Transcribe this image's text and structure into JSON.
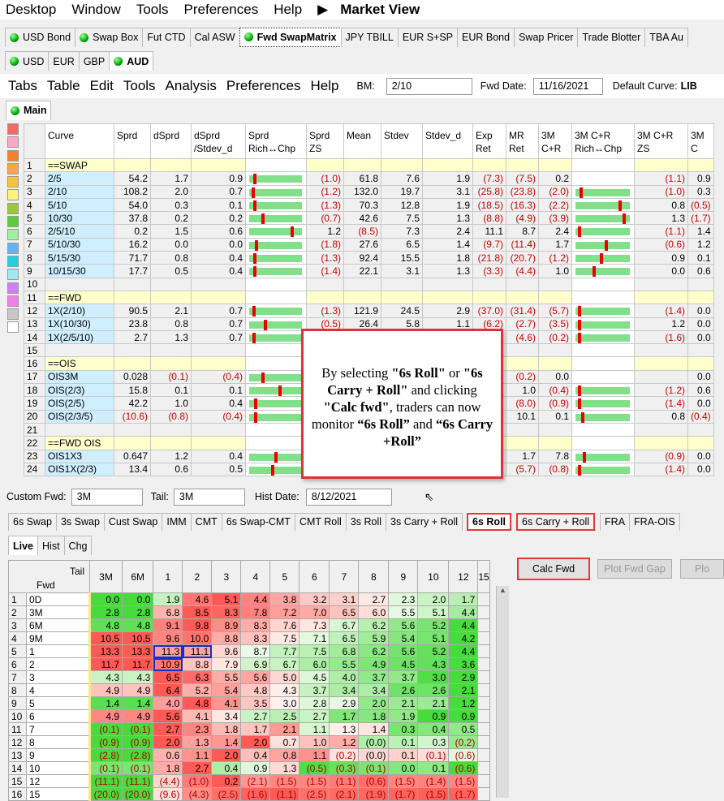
{
  "menubar": {
    "items": [
      "Desktop",
      "Window",
      "Tools",
      "Preferences",
      "Help"
    ],
    "title": "Market View"
  },
  "tabs_top": [
    "USD Bond",
    "Swap Box",
    "Fut CTD",
    "Cal ASW",
    "Fwd SwapMatrix",
    "JPY TBILL",
    "EUR S+SP",
    "EUR Bond",
    "Swap Pricer",
    "Trade Blotter",
    "TBA Au"
  ],
  "tabs_ccy": [
    "USD",
    "EUR",
    "GBP",
    "AUD"
  ],
  "menu2": {
    "items": [
      "Tabs",
      "Table",
      "Edit",
      "Tools",
      "Analysis",
      "Preferences",
      "Help"
    ],
    "bm_label": "BM:",
    "bm_value": "2/10",
    "fwd_date_label": "Fwd Date:",
    "fwd_date": "11/16/2021",
    "default_curve_label": "Default Curve:",
    "default_curve": "LIB"
  },
  "main_tab": "Main",
  "grid1": {
    "headers": [
      "Curve",
      "Sprd",
      "dSprd",
      "dSprd /Stdev_d",
      "Sprd Rich↔Chp",
      "Sprd ZS",
      "Mean",
      "Stdev",
      "Stdev_d",
      "Exp Ret",
      "MR Ret",
      "3M C+R",
      "3M C+R Rich↔Chp",
      "3M C+R ZS",
      "3M C"
    ],
    "rows": [
      [
        "1",
        "==SWAP",
        "",
        "",
        "",
        "",
        "",
        "",
        "",
        "",
        "",
        "",
        "",
        "",
        "",
        ""
      ],
      [
        "2",
        "2/5",
        "54.2",
        "1.7",
        "0.9",
        "",
        "(1.0)",
        "61.8",
        "7.6",
        "1.9",
        "(7.3)",
        "(7.5)",
        "0.2",
        "",
        "(1.1)",
        "0.9"
      ],
      [
        "3",
        "2/10",
        "108.2",
        "2.0",
        "0.7",
        "",
        "(1.2)",
        "132.0",
        "19.7",
        "3.1",
        "(25.8)",
        "(23.8)",
        "(2.0)",
        "",
        "(1.0)",
        "0.3"
      ],
      [
        "4",
        "5/10",
        "54.0",
        "0.3",
        "0.1",
        "",
        "(1.3)",
        "70.3",
        "12.8",
        "1.9",
        "(18.5)",
        "(16.3)",
        "(2.2)",
        "",
        "0.8",
        "(0.5)"
      ],
      [
        "5",
        "10/30",
        "37.8",
        "0.2",
        "0.2",
        "",
        "(0.7)",
        "42.6",
        "7.5",
        "1.3",
        "(8.8)",
        "(4.9)",
        "(3.9)",
        "",
        "1.3",
        "(1.7)"
      ],
      [
        "6",
        "2/5/10",
        "0.2",
        "1.5",
        "0.6",
        "",
        "1.2",
        "(8.5)",
        "7.3",
        "2.4",
        "11.1",
        "8.7",
        "2.4",
        "",
        "(1.1)",
        "1.4"
      ],
      [
        "7",
        "5/10/30",
        "16.2",
        "0.0",
        "0.0",
        "",
        "(1.8)",
        "27.6",
        "6.5",
        "1.4",
        "(9.7)",
        "(11.4)",
        "1.7",
        "",
        "(0.6)",
        "1.2"
      ],
      [
        "8",
        "5/15/30",
        "71.7",
        "0.8",
        "0.4",
        "",
        "(1.3)",
        "92.4",
        "15.5",
        "1.8",
        "(21.8)",
        "(20.7)",
        "(1.2)",
        "",
        "0.9",
        "0.1"
      ],
      [
        "9",
        "10/15/30",
        "17.7",
        "0.5",
        "0.4",
        "",
        "(1.4)",
        "22.1",
        "3.1",
        "1.3",
        "(3.3)",
        "(4.4)",
        "1.0",
        "",
        "0.0",
        "0.6"
      ],
      [
        "10",
        "",
        "",
        "",
        "",
        "",
        "",
        "",
        "",
        "",
        "",
        "",
        "",
        "",
        "",
        ""
      ],
      [
        "11",
        "==FWD",
        "",
        "",
        "",
        "",
        "",
        "",
        "",
        "",
        "",
        "",
        "",
        "",
        "",
        ""
      ],
      [
        "12",
        "1X(2/10)",
        "90.5",
        "2.1",
        "0.7",
        "",
        "(1.3)",
        "121.9",
        "24.5",
        "2.9",
        "(37.0)",
        "(31.4)",
        "(5.7)",
        "",
        "(1.4)",
        "0.0"
      ],
      [
        "13",
        "1X(10/30)",
        "23.8",
        "0.8",
        "0.7",
        "",
        "(0.5)",
        "26.4",
        "5.8",
        "1.1",
        "(6.2)",
        "(2.7)",
        "(3.5)",
        "",
        "1.2",
        "0.0"
      ],
      [
        "14",
        "1X(2/5/10)",
        "2.7",
        "1.3",
        "0.7",
        "",
        "",
        "",
        "",
        "",
        "(5.8)",
        "(4.6)",
        "(0.2)",
        "",
        "(1.6)",
        "0.0"
      ],
      [
        "15",
        "",
        "",
        "",
        "",
        "",
        "",
        "",
        "",
        "",
        "",
        "",
        "",
        "",
        "",
        ""
      ],
      [
        "16",
        "==OIS",
        "",
        "",
        "",
        "",
        "",
        "",
        "",
        "",
        "",
        "",
        "",
        "",
        "",
        ""
      ],
      [
        "17",
        "OIS3M",
        "0.028",
        "(0.1)",
        "(0.4)",
        "",
        "",
        "",
        "",
        "",
        "(0.2)",
        "(0.2)",
        "0.0",
        "",
        "",
        "0.0"
      ],
      [
        "18",
        "OIS(2/3)",
        "15.8",
        "0.1",
        "0.1",
        "",
        "",
        "",
        "",
        "",
        "1.7",
        "1.0",
        "(0.4)",
        "",
        "(1.2)",
        "0.6"
      ],
      [
        "19",
        "OIS(2/5)",
        "42.2",
        "1.0",
        "0.4",
        "",
        "",
        "",
        "",
        "",
        "(8.9)",
        "(8.0)",
        "(0.9)",
        "",
        "(1.4)",
        "0.0"
      ],
      [
        "20",
        "OIS(2/3/5)",
        "(10.6)",
        "(0.8)",
        "(0.4)",
        "",
        "",
        "",
        "",
        "",
        "10.2",
        "10.1",
        "0.1",
        "",
        "0.8",
        "(0.4)"
      ],
      [
        "21",
        "",
        "",
        "",
        "",
        "",
        "",
        "",
        "",
        "",
        "",
        "",
        "",
        "",
        "",
        ""
      ],
      [
        "22",
        "==FWD OIS",
        "",
        "",
        "",
        "",
        "",
        "",
        "",
        "",
        "",
        "",
        "",
        "",
        "",
        ""
      ],
      [
        "23",
        "OIS1X3",
        "0.647",
        "1.2",
        "0.4",
        "",
        "",
        "",
        "",
        "",
        "9.4",
        "1.7",
        "7.8",
        "",
        "(0.9)",
        "0.0"
      ],
      [
        "24",
        "OIS1X(2/3)",
        "13.4",
        "0.6",
        "0.5",
        "",
        "",
        "",
        "",
        "",
        "(6.5)",
        "(5.7)",
        "(0.8)",
        "",
        "(1.4)",
        "0.0"
      ]
    ]
  },
  "callout": {
    "l1": "By selecting ",
    "b1": "\"6s Roll\"",
    "l2": " or ",
    "b2": "\"6s Carry + Roll\"",
    "l3": " and clicking ",
    "b3": "\"Calc fwd\"",
    "l4": ", traders can now monitor ",
    "b4": "“6s Roll”",
    "l5": " and ",
    "b5": "“6s Carry +Roll”"
  },
  "lower": {
    "custom_fwd_label": "Custom Fwd:",
    "custom_fwd": "3M",
    "tail_label": "Tail:",
    "tail": "3M",
    "hist_date_label": "Hist Date:",
    "hist_date": "8/12/2021",
    "tabs": [
      "6s Swap",
      "3s Swap",
      "Cust Swap",
      "IMM",
      "CMT",
      "6s Swap-CMT",
      "CMT Roll",
      "3s Roll",
      "3s Carry + Roll",
      "6s Roll",
      "6s Carry + Roll",
      "FRA",
      "FRA-OIS"
    ],
    "subtabs": [
      "Live",
      "Hist",
      "Chg"
    ],
    "buttons": {
      "calc": "Calc Fwd",
      "plot": "Plot Fwd Gap",
      "plo": "Plo"
    }
  },
  "grid2": {
    "corner_tail": "Tail",
    "corner_fwd": "Fwd",
    "cols": [
      "3M",
      "6M",
      "1",
      "2",
      "3",
      "4",
      "5",
      "6",
      "7",
      "8",
      "9",
      "10",
      "12",
      "15"
    ],
    "rows": [
      [
        "1",
        "0D",
        "0.0",
        "0.0",
        "1.9",
        "4.6",
        "5.1",
        "4.4",
        "3.8",
        "3.2",
        "3.1",
        "2.7",
        "2.3",
        "2.0",
        "1.7",
        ""
      ],
      [
        "2",
        "3M",
        "2.8",
        "2.8",
        "6.8",
        "8.5",
        "8.3",
        "7.8",
        "7.2",
        "7.0",
        "6.5",
        "6.0",
        "5.5",
        "5.1",
        "4.4",
        ""
      ],
      [
        "3",
        "6M",
        "4.8",
        "4.8",
        "9.1",
        "9.8",
        "8.9",
        "8.3",
        "7.6",
        "7.3",
        "6.7",
        "6.2",
        "5.6",
        "5.2",
        "4.4",
        ""
      ],
      [
        "4",
        "9M",
        "10.5",
        "10.5",
        "9.6",
        "10.0",
        "8.8",
        "8.3",
        "7.5",
        "7.1",
        "6.5",
        "5.9",
        "5.4",
        "5.1",
        "4.2",
        ""
      ],
      [
        "5",
        "1",
        "13.3",
        "13.3",
        "11.3",
        "11.1",
        "9.6",
        "8.7",
        "7.7",
        "7.5",
        "6.8",
        "6.2",
        "5.6",
        "5.2",
        "4.4",
        ""
      ],
      [
        "6",
        "2",
        "11.7",
        "11.7",
        "10.9",
        "8.8",
        "7.9",
        "6.9",
        "6.7",
        "6.0",
        "5.5",
        "4.9",
        "4.5",
        "4.3",
        "3.6",
        ""
      ],
      [
        "7",
        "3",
        "4.3",
        "4.3",
        "6.5",
        "6.3",
        "5.5",
        "5.6",
        "5.0",
        "4.5",
        "4.0",
        "3.7",
        "3.7",
        "3.0",
        "2.9",
        ""
      ],
      [
        "8",
        "4",
        "4.9",
        "4.9",
        "6.4",
        "5.2",
        "5.4",
        "4.8",
        "4.3",
        "3.7",
        "3.4",
        "3.4",
        "2.6",
        "2.6",
        "2.1",
        ""
      ],
      [
        "9",
        "5",
        "1.4",
        "1.4",
        "4.0",
        "4.8",
        "4.1",
        "3.5",
        "3.0",
        "2.8",
        "2.9",
        "2.0",
        "2.1",
        "2.1",
        "1.2",
        ""
      ],
      [
        "10",
        "6",
        "4.9",
        "4.9",
        "5.6",
        "4.1",
        "3.4",
        "2.7",
        "2.5",
        "2.7",
        "1.7",
        "1.8",
        "1.9",
        "0.9",
        "0.9",
        ""
      ],
      [
        "11",
        "7",
        "(0.1)",
        "(0.1)",
        "2.7",
        "2.3",
        "1.8",
        "1.7",
        "2.1",
        "1.1",
        "1.3",
        "1.4",
        "0.3",
        "0.4",
        "0.5",
        ""
      ],
      [
        "12",
        "8",
        "(0.9)",
        "(0.9)",
        "2.0",
        "1.3",
        "1.4",
        "2.0",
        "0.7",
        "1.0",
        "1.2",
        "(0.0)",
        "0.1",
        "0.3",
        "(0.2)",
        ""
      ],
      [
        "13",
        "9",
        "(2.8)",
        "(2.8)",
        "0.6",
        "1.1",
        "2.0",
        "0.4",
        "0.8",
        "1.1",
        "(0.2)",
        "(0.0)",
        "0.1",
        "(0.1)",
        "(0.6)",
        ""
      ],
      [
        "14",
        "10",
        "(0.1)",
        "(0.1)",
        "1.8",
        "2.7",
        "0.4",
        "0.9",
        "1.3",
        "(0.5)",
        "(0.3)",
        "(0.1)",
        "0.0",
        "0.1",
        "(0.6)",
        ""
      ],
      [
        "15",
        "12",
        "(11.1)",
        "(11.1)",
        "(4.4)",
        "(1.0)",
        "0.2",
        "(2.1)",
        "(1.5)",
        "(1.5)",
        "(1.1)",
        "(0.6)",
        "(1.5)",
        "(1.4)",
        "(1.5)",
        ""
      ],
      [
        "16",
        "15",
        "(20.0)",
        "(20.0)",
        "(9.6)",
        "(4.3)",
        "(2.5)",
        "(1.6)",
        "(1.1)",
        "(2.5)",
        "(2.1)",
        "(1.9)",
        "(1.7)",
        "(1.5)",
        "(1.7)",
        ""
      ]
    ]
  },
  "colors": {
    "accent_red": "#e33333",
    "neg_text": "#cc0000"
  }
}
